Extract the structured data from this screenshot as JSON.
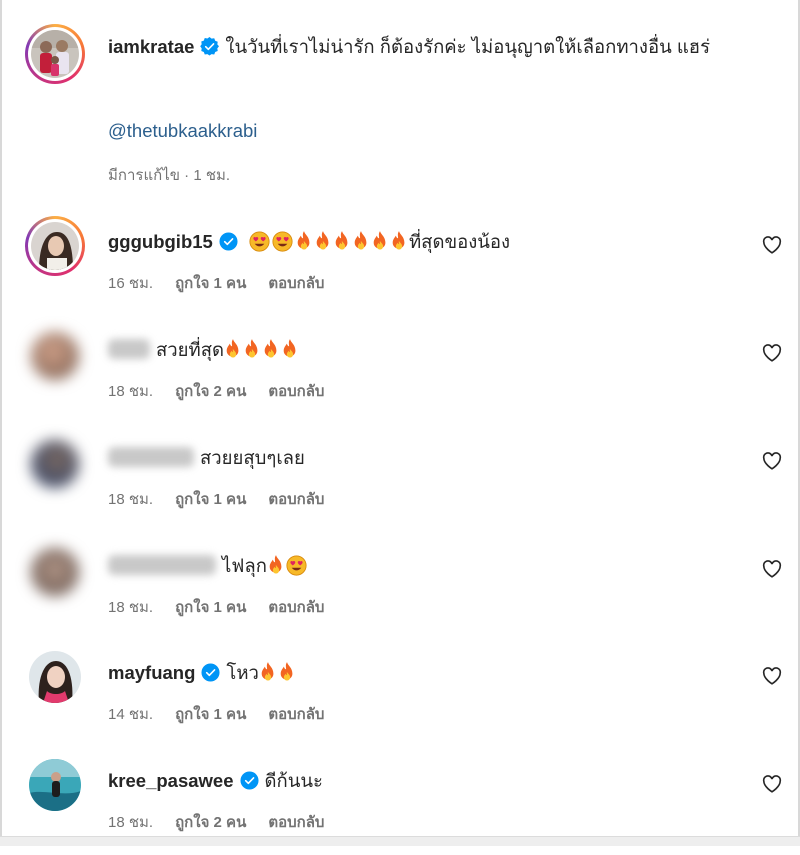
{
  "caption": {
    "username": "iamkratae",
    "text": "ในวันที่เราไม่น่ารัก ก็ต้องรักค่ะ ไม่อนุญาตให้เลือกทางอื่น แฮร่",
    "mention": "@thetubkaakkrabi",
    "edited_label": "มีการแก้ไข",
    "time": "1 ชม."
  },
  "comments": [
    {
      "username": "gggubgib15",
      "verified": true,
      "text": "ที่สุดของน้อง",
      "time": "16 ชม.",
      "likes": "ถูกใจ 1 คน",
      "reply": "ตอบกลับ"
    },
    {
      "username": "",
      "verified": false,
      "text": "สวยที่สุด",
      "time": "18 ชม.",
      "likes": "ถูกใจ 2 คน",
      "reply": "ตอบกลับ"
    },
    {
      "username": "",
      "verified": false,
      "text": "สวยยสุบๆเลย",
      "time": "18 ชม.",
      "likes": "ถูกใจ 1 คน",
      "reply": "ตอบกลับ"
    },
    {
      "username": "",
      "verified": false,
      "text": "ไฟลุก",
      "time": "18 ชม.",
      "likes": "ถูกใจ 1 คน",
      "reply": "ตอบกลับ"
    },
    {
      "username": "mayfuang",
      "verified": true,
      "text": "โหว",
      "time": "14 ชม.",
      "likes": "ถูกใจ 1 คน",
      "reply": "ตอบกลับ"
    },
    {
      "username": "kree_pasawee",
      "verified": true,
      "text": "ดีก้นนะ",
      "time": "18 ชม.",
      "likes": "ถูกใจ 2 คน",
      "reply": "ตอบกลับ"
    }
  ],
  "colors": {
    "verified": "#0095f6",
    "link": "#2c5f8d",
    "meta": "#737373"
  },
  "icons": [
    "verified-badge-icon",
    "heart-outline-icon",
    "fire-emoji",
    "heart-eyes-emoji"
  ]
}
